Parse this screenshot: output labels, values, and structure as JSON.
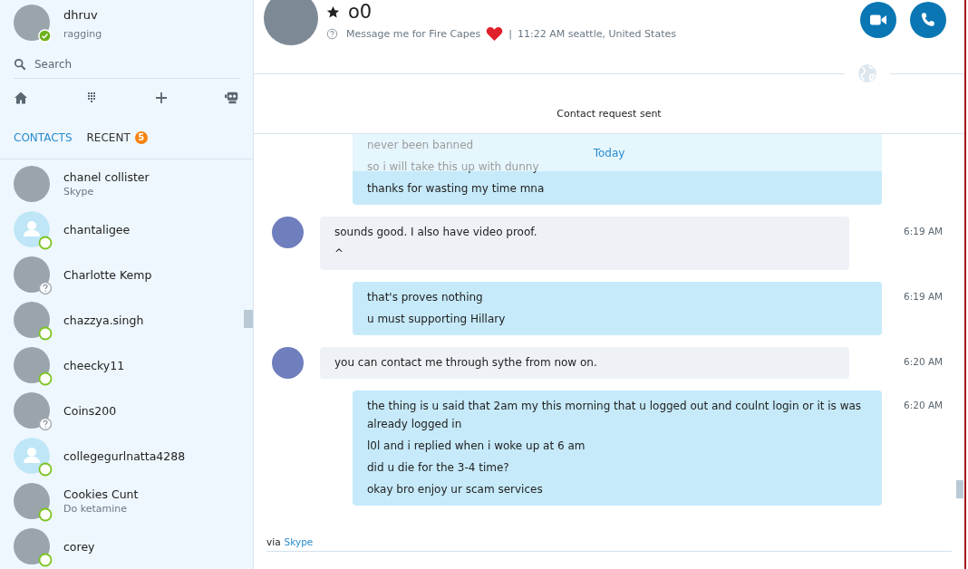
{
  "profile": {
    "name": "dhruv",
    "mood": "ragging",
    "online": true
  },
  "search": {
    "placeholder": "Search"
  },
  "tabs": [
    {
      "label": "CONTACTS",
      "selected": true
    },
    {
      "label": "RECENT",
      "selected": false,
      "badge": "5"
    }
  ],
  "contacts": [
    {
      "name": "chanel collister",
      "mood": "Skype",
      "photo": true,
      "online": false,
      "unknown": false
    },
    {
      "name": "chantaligee",
      "photo": false,
      "online": true,
      "unknown": false
    },
    {
      "name": "Charlotte Kemp",
      "photo": true,
      "online": false,
      "unknown": true
    },
    {
      "name": "chazzya.singh",
      "photo": true,
      "online": true,
      "unknown": false
    },
    {
      "name": "cheecky11",
      "photo": true,
      "online": true,
      "unknown": false
    },
    {
      "name": "Coins200",
      "photo": true,
      "online": false,
      "unknown": true
    },
    {
      "name": "collegegurlnatta4288",
      "photo": false,
      "online": true,
      "unknown": false
    },
    {
      "name": "Cookies Cunt",
      "mood": "Do ketamine",
      "photo": true,
      "online": true,
      "unknown": false
    },
    {
      "name": "corey",
      "photo": true,
      "online": true,
      "unknown": false
    }
  ],
  "conversation": {
    "name": "o0",
    "favorite": true,
    "unknown": true,
    "mood": "Message me for Fire Capes",
    "separator": "|",
    "location": "11:22 AM seattle, United States",
    "notice": "Contact request sent",
    "date_label": "Today",
    "messages": [
      {
        "kind": "outgoing",
        "lines": [
          "never been banned",
          "so i will take this up with dunny",
          "thanks for wasting my time mna"
        ]
      },
      {
        "kind": "incoming",
        "time": "6:19 AM",
        "lines": [
          "sounds good. I also have video proof.",
          "^"
        ]
      },
      {
        "kind": "outgoing",
        "time": "6:19 AM",
        "lines": [
          "that's proves nothing",
          "u must supporting Hillary"
        ]
      },
      {
        "kind": "incoming",
        "time": "6:20 AM",
        "lines": [
          "you can contact me through sythe from now on."
        ]
      },
      {
        "kind": "outgoing",
        "time": "6:20 AM",
        "lines": [
          "the thing is u said that 2am my this morning that u logged out and coulnt login or it is was already logged in",
          "l0l and i replied when i woke up at 6 am",
          "did u die for the 3-4 time?",
          "okay bro enjoy ur scam services"
        ]
      }
    ],
    "footer": {
      "prefix": "via",
      "link": "Skype"
    }
  }
}
